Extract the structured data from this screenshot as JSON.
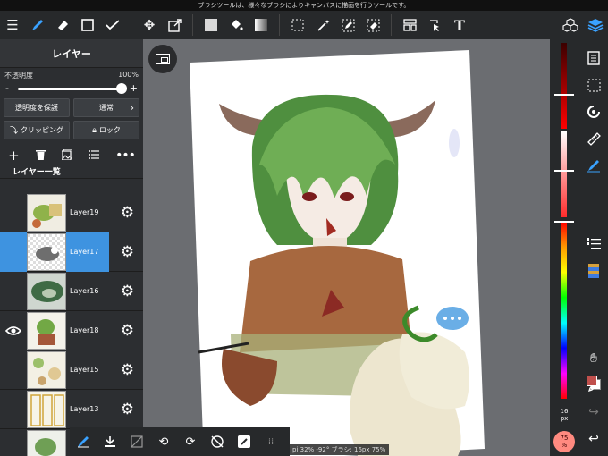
{
  "hint_text": "ブラシツールは、様々なブラシによりキャンバスに描画を行うツールです。",
  "toolbar": {
    "icons": [
      "menu-icon",
      "brush-icon",
      "eraser-icon",
      "square-icon",
      "correction-icon",
      "move-icon",
      "transform-icon",
      "fill-color-icon",
      "bucket-icon",
      "gradient-icon",
      "select-icon",
      "magic-wand-icon",
      "select-pen-icon",
      "select-eraser-icon",
      "layout-icon",
      "select-layer-icon",
      "text-icon",
      "materials-icon",
      "layers-icon"
    ],
    "active": "brush-icon"
  },
  "layer_panel": {
    "title": "レイヤー",
    "opacity_label": "不透明度",
    "opacity_value": "100%",
    "opacity_fraction": 1.0,
    "minus": "-",
    "plus": "+",
    "protect_alpha": "透明度を保護",
    "blend_mode": "通常",
    "clipping": "クリッピング",
    "lock": "ロック",
    "list_title": "レイヤー一覧",
    "layers": [
      {
        "name": "Layer19",
        "visible": false,
        "selected": false
      },
      {
        "name": "Layer17",
        "visible": false,
        "selected": true
      },
      {
        "name": "Layer16",
        "visible": false,
        "selected": false
      },
      {
        "name": "Layer18",
        "visible": true,
        "selected": false
      },
      {
        "name": "Layer15",
        "visible": false,
        "selected": false
      },
      {
        "name": "Layer13",
        "visible": false,
        "selected": false
      },
      {
        "name": "",
        "visible": false,
        "selected": false
      }
    ]
  },
  "status_text": "pi 32% -92° ブラシ: 16px 75%",
  "brush_size": "16",
  "brush_size_unit": "px",
  "zoom_badge": "75",
  "zoom_badge_unit": "%",
  "colors": {
    "accent": "#3aa2ff",
    "foreground": "#c0504d",
    "selected_layer": "#3e93e0"
  }
}
